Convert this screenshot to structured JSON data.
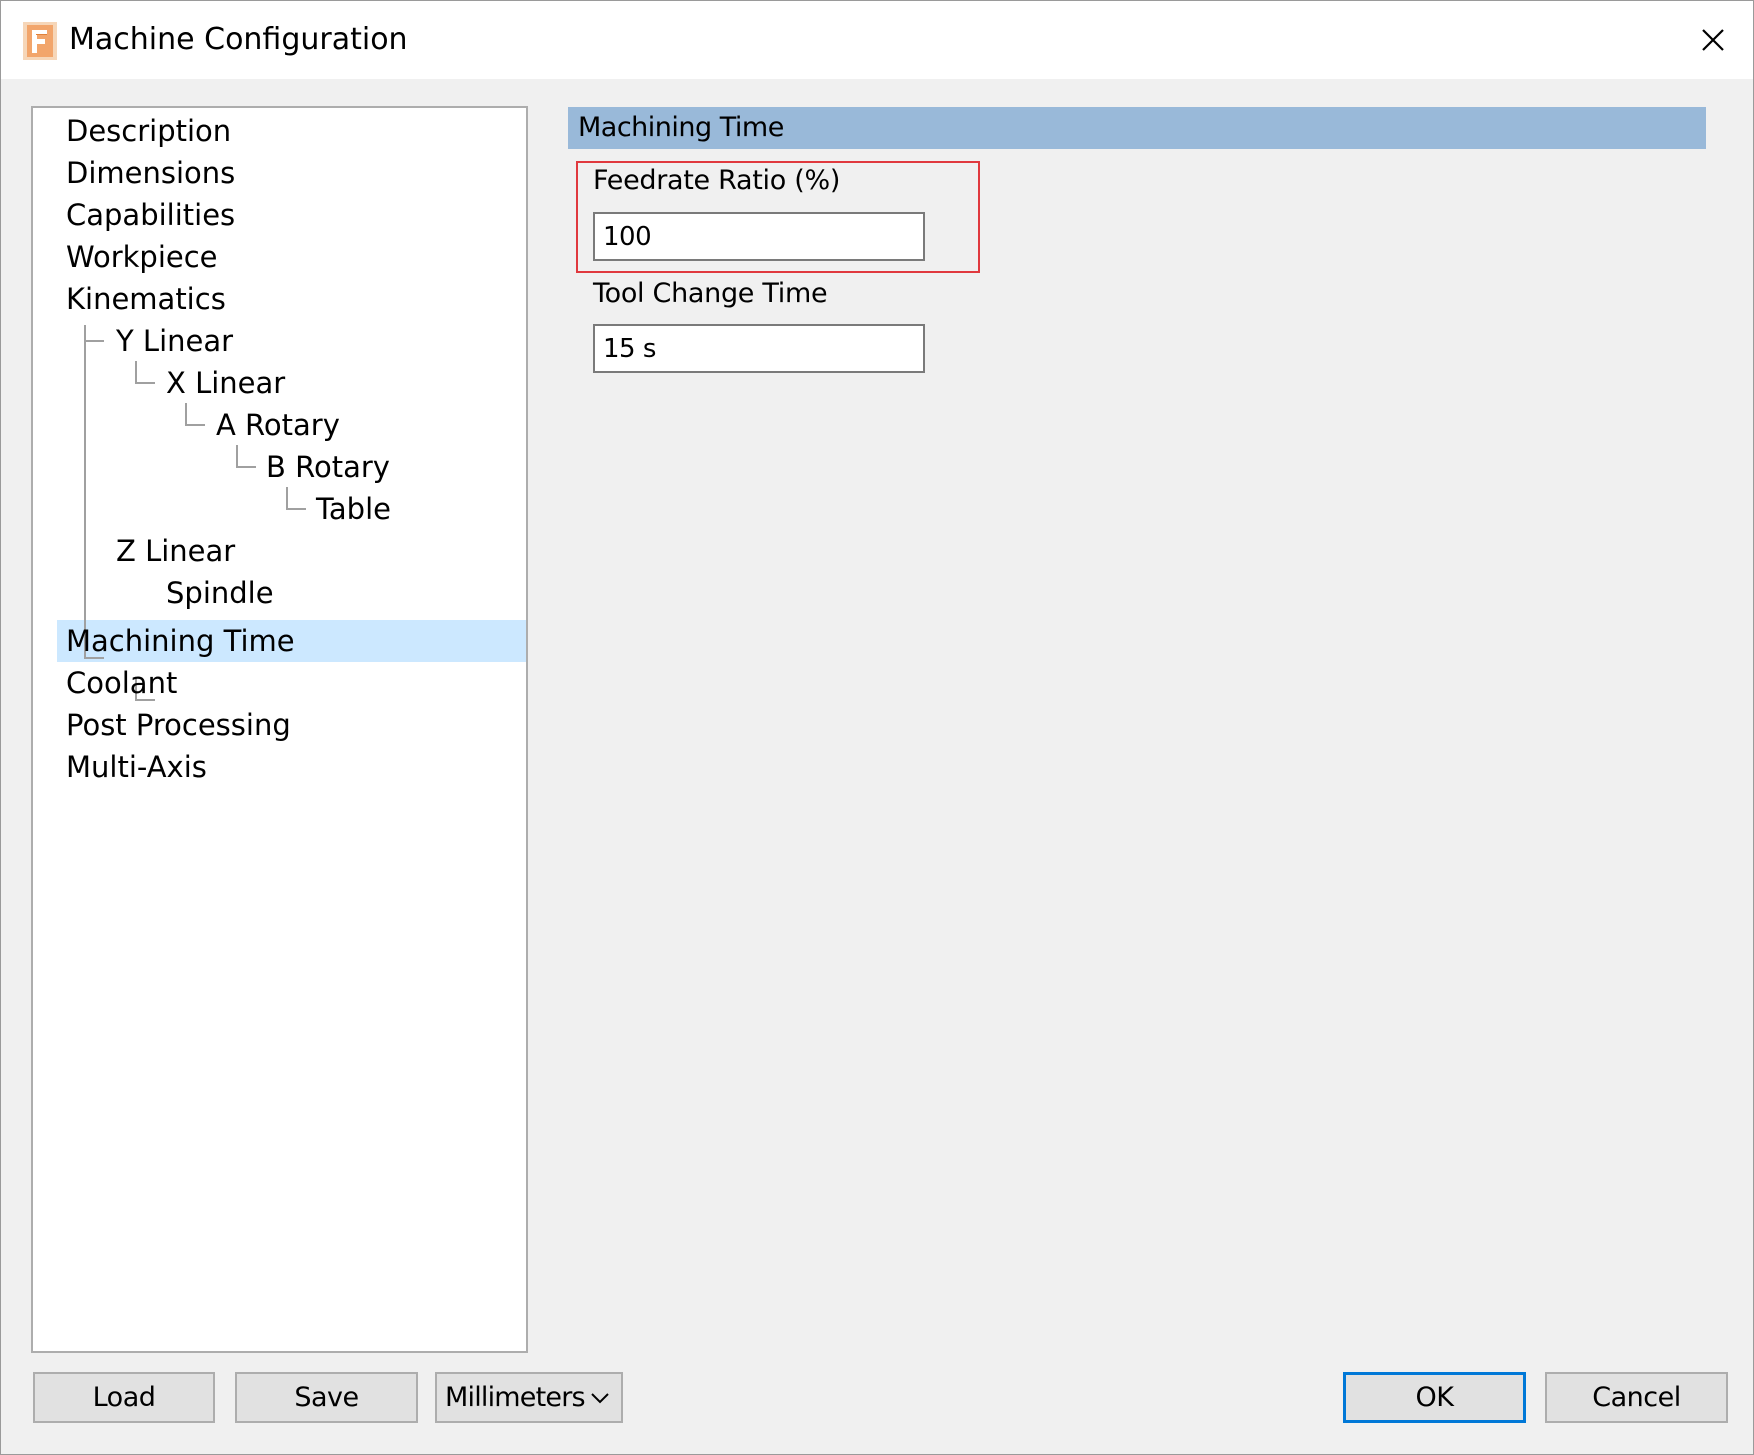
{
  "window": {
    "title": "Machine Configuration",
    "app_icon": "fusion-app-icon",
    "close_icon": "close-icon"
  },
  "tree": {
    "items": [
      {
        "label": "Description"
      },
      {
        "label": "Dimensions"
      },
      {
        "label": "Capabilities"
      },
      {
        "label": "Workpiece"
      },
      {
        "label": "Kinematics"
      },
      {
        "label": "Y Linear"
      },
      {
        "label": "X Linear"
      },
      {
        "label": "A Rotary"
      },
      {
        "label": "B Rotary"
      },
      {
        "label": "Table"
      },
      {
        "label": "Z Linear"
      },
      {
        "label": "Spindle"
      },
      {
        "label": "Machining Time"
      },
      {
        "label": "Coolant"
      },
      {
        "label": "Post Processing"
      },
      {
        "label": "Multi-Axis"
      }
    ],
    "selected": "Machining Time",
    "selection_color": "#cce8ff"
  },
  "section": {
    "header": "Machining Time",
    "header_color": "#99b9d9",
    "fields": [
      {
        "label": "Feedrate Ratio (%)",
        "value": "100"
      },
      {
        "label": "Tool Change Time",
        "value": "15 s"
      }
    ],
    "highlight_color": "#e0393e"
  },
  "buttons": {
    "load": "Load",
    "save": "Save",
    "units": "Millimeters",
    "ok": "OK",
    "cancel": "Cancel",
    "default_border_color": "#0078d7"
  }
}
